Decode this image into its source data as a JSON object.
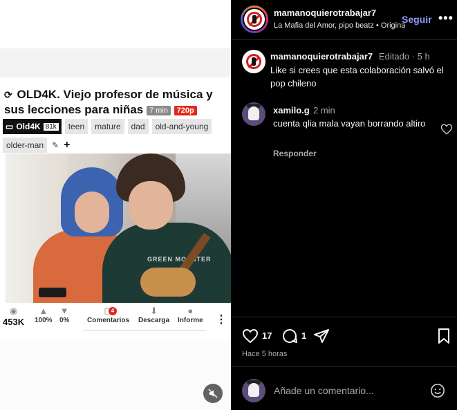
{
  "media": {
    "title": "OLD4K. Viejo profesor de música y sus lecciones para niñas",
    "refresh_glyph": "⟳",
    "duration": "7 min",
    "quality": "720p",
    "channel": {
      "name": "Old4K",
      "subs": "81k"
    },
    "tags": [
      "teen",
      "mature",
      "dad",
      "old-and-young",
      "older-man"
    ],
    "shirt_text": "GREEN MONSTER",
    "stats": {
      "views": "453K",
      "like_pct": "100%",
      "dislike_pct": "0%",
      "comments_label": "Comentarios",
      "comments_badge": "4",
      "download_label": "Descarga",
      "report_label": "Informe"
    },
    "mute_icon": "speaker-muted-icon"
  },
  "post": {
    "username": "mamanoquierotrabajar7",
    "audio": "La Mafia del Amor, pipo beatz • Original audio",
    "follow_label": "Seguir",
    "caption": {
      "user": "mamanoquierotrabajar7",
      "meta": "Editado · 5 h",
      "text": "Like si crees que esta colaboración salvó el pop chileno"
    },
    "comments": [
      {
        "user": "xamilo.g",
        "time": "2 min",
        "text": "cuenta qlia mala vayan borrando altiro",
        "reply_label": "Responder"
      }
    ],
    "likes": "17",
    "comment_count": "1",
    "time_ago": "Hace 5 horas",
    "add_comment_placeholder": "Añade un comentario...",
    "accent": "#8d9bff"
  }
}
